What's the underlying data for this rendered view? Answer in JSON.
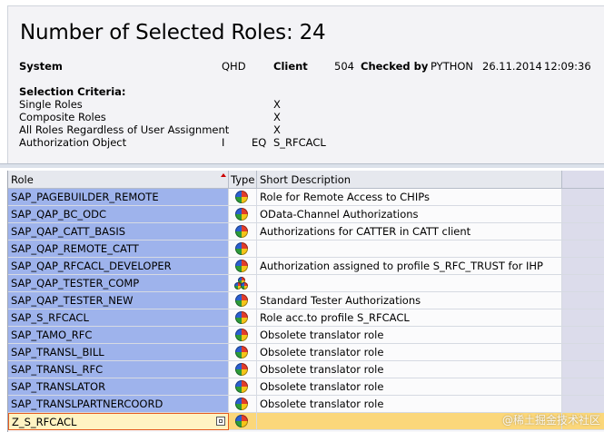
{
  "header": {
    "title": "Number of Selected Roles: 24",
    "system_label": "System",
    "system_value": "QHD",
    "client_label": "Client",
    "client_value": "504",
    "checked_by_label": "Checked by",
    "checked_by_value": "PYTHON",
    "date": "26.11.2014",
    "time": "12:09:36"
  },
  "criteria": {
    "heading": "Selection Criteria:",
    "items": [
      {
        "label": "Single Roles",
        "sign": "",
        "option": "",
        "value": "X"
      },
      {
        "label": "Composite Roles",
        "sign": "",
        "option": "",
        "value": "X"
      },
      {
        "label": "All Roles Regardless of User Assignment",
        "sign": "",
        "option": "",
        "value": "X"
      },
      {
        "label": "Authorization Object",
        "sign": "I",
        "option": "EQ",
        "value": "S_RFCACL"
      }
    ]
  },
  "table": {
    "columns": [
      "Role",
      "Type",
      "Short Description"
    ],
    "rows": [
      {
        "role": "SAP_PAGEBUILDER_REMOTE",
        "type_icon": "single-role-icon",
        "desc": "Role for Remote Access to CHIPs"
      },
      {
        "role": "SAP_QAP_BC_ODC",
        "type_icon": "single-role-icon",
        "desc": "OData-Channel Authorizations"
      },
      {
        "role": "SAP_QAP_CATT_BASIS",
        "type_icon": "single-role-icon",
        "desc": "Authorizations for CATTER in CATT client"
      },
      {
        "role": "SAP_QAP_REMOTE_CATT",
        "type_icon": "single-role-icon",
        "desc": ""
      },
      {
        "role": "SAP_QAP_RFCACL_DEVELOPER",
        "type_icon": "single-role-icon",
        "desc": "Authorization assigned to profile S_RFC_TRUST for  IHP"
      },
      {
        "role": "SAP_QAP_TESTER_COMP",
        "type_icon": "composite-role-icon",
        "desc": ""
      },
      {
        "role": "SAP_QAP_TESTER_NEW",
        "type_icon": "single-role-icon",
        "desc": "Standard Tester Authorizations"
      },
      {
        "role": "SAP_S_RFCACL",
        "type_icon": "single-role-icon",
        "desc": "Role acc.to profile S_RFCACL"
      },
      {
        "role": "SAP_TAMO_RFC",
        "type_icon": "single-role-icon",
        "desc": "Obsolete translator role"
      },
      {
        "role": "SAP_TRANSL_BILL",
        "type_icon": "single-role-icon",
        "desc": "Obsolete translator role"
      },
      {
        "role": "SAP_TRANSL_RFC",
        "type_icon": "single-role-icon",
        "desc": "Obsolete translator role"
      },
      {
        "role": "SAP_TRANSLATOR",
        "type_icon": "single-role-icon",
        "desc": "Obsolete translator role"
      },
      {
        "role": "SAP_TRANSLPARTNERCOORD",
        "type_icon": "single-role-icon",
        "desc": "Obsolete translator role"
      },
      {
        "role": "Z_S_RFCACL",
        "type_icon": "single-role-icon",
        "desc": ""
      }
    ],
    "selected_index": 13
  },
  "watermark": "@稀土掘金技术社区"
}
